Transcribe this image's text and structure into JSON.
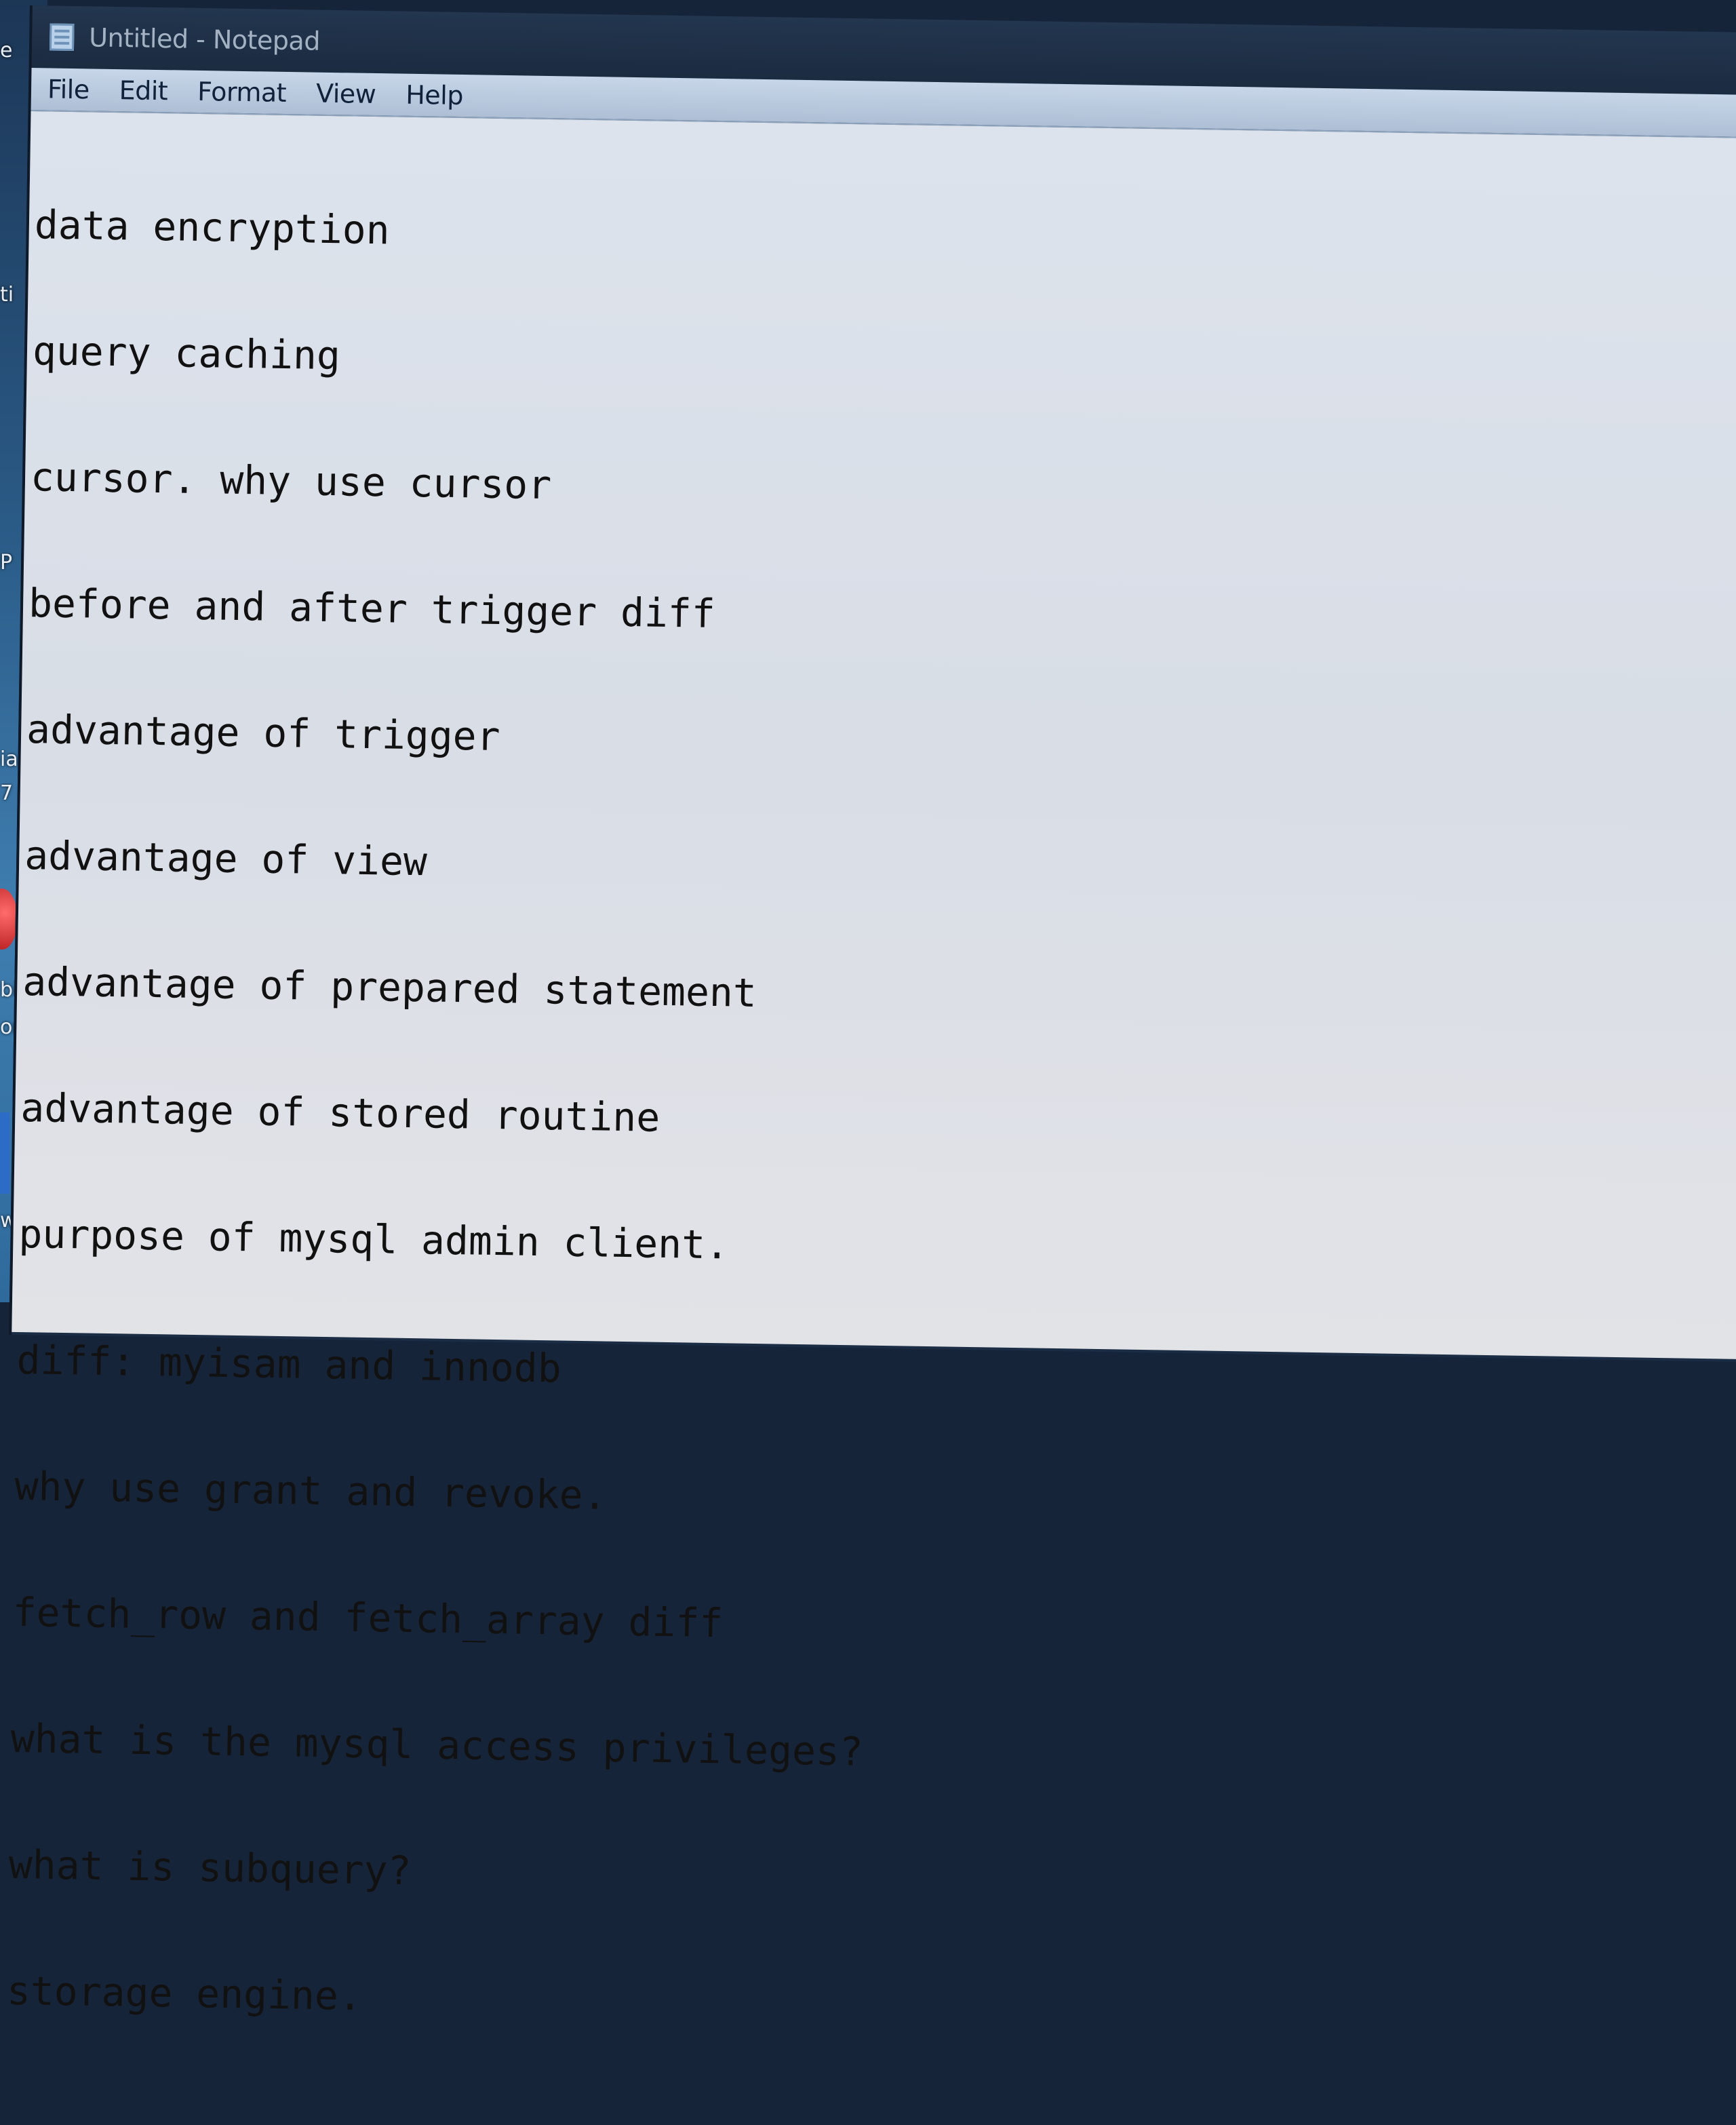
{
  "window": {
    "title": "Untitled - Notepad",
    "icon": "notepad-icon"
  },
  "menu": {
    "items": [
      "File",
      "Edit",
      "Format",
      "View",
      "Help"
    ]
  },
  "editor": {
    "lines": [
      "data encryption",
      "query caching",
      "cursor. why use cursor",
      "before and after trigger diff",
      "advantage of trigger",
      "advantage of view",
      "advantage of prepared statement",
      "advantage of stored routine",
      "purpose of mysql admin client.",
      "diff: myisam and innodb",
      "why use grant and revoke.",
      "fetch_row and fetch_array diff",
      "what is the mysql access privileges?",
      "what is subquery?",
      "storage engine."
    ]
  },
  "desktop": {
    "fragments": [
      "e",
      "ti",
      "P",
      "ia",
      "7",
      "bi",
      "or",
      "we"
    ]
  }
}
